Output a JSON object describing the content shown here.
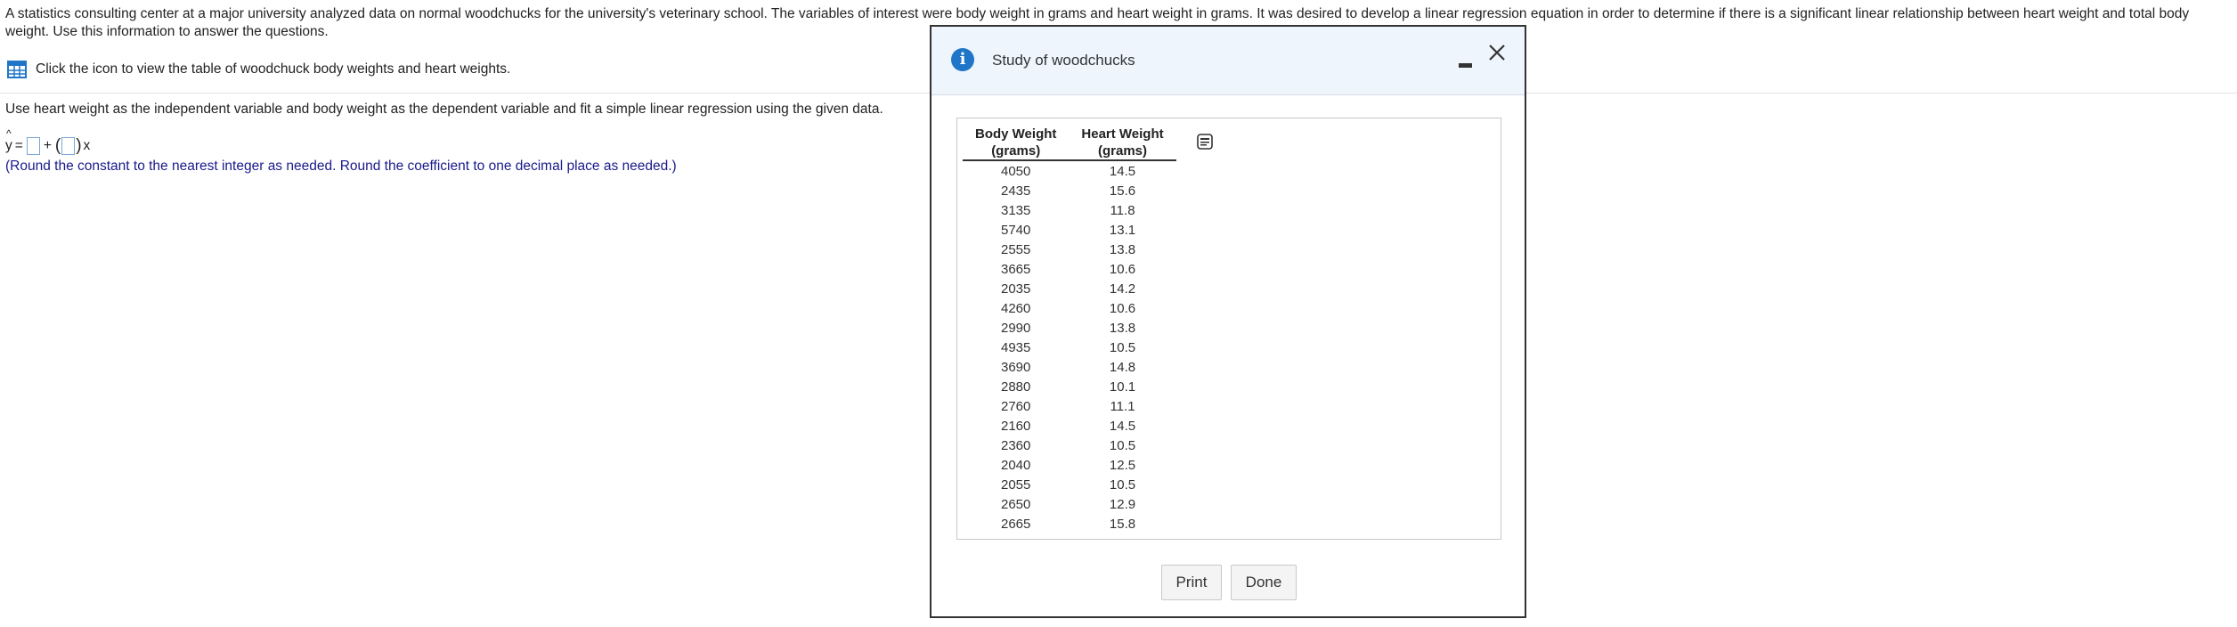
{
  "question": {
    "intro": "A statistics consulting center at a major university analyzed data on normal woodchucks for the university's veterinary school. The variables of interest were body weight in grams and heart weight in grams. It was desired to develop a linear regression equation in order to determine if there is a significant linear relationship between heart weight and total body weight. Use this information to answer the questions.",
    "icon_prompt": "Click the icon to view the table of woodchuck body weights and heart weights.",
    "instruction": "Use heart weight as the independent variable and body weight as the dependent variable and fit a simple linear regression using the given data.",
    "equation": {
      "lhs": "y",
      "hat": "^",
      "equals": "=",
      "plus": "+",
      "open_paren": "(",
      "close_paren": ")",
      "var": "x"
    },
    "hint": "(Round the constant to the nearest integer as needed. Round the coefficient to one decimal place as needed.)"
  },
  "icons": {
    "table": "table-grid-icon",
    "info": "info-icon",
    "minimize": "minimize-icon",
    "close": "close-icon",
    "copy": "copy-icon"
  },
  "colors": {
    "accent": "#1f76c8",
    "hint_text": "#1a1a8c",
    "modal_header": "#eef5fd"
  },
  "modal": {
    "title": "Study of woodchucks",
    "info_glyph": "i",
    "table": {
      "headers": [
        {
          "line1": "Body Weight",
          "line2": "(grams)"
        },
        {
          "line1": "Heart Weight",
          "line2": "(grams)"
        }
      ],
      "rows": [
        [
          "4050",
          "14.5"
        ],
        [
          "2435",
          "15.6"
        ],
        [
          "3135",
          "11.8"
        ],
        [
          "5740",
          "13.1"
        ],
        [
          "2555",
          "13.8"
        ],
        [
          "3665",
          "10.6"
        ],
        [
          "2035",
          "14.2"
        ],
        [
          "4260",
          "10.6"
        ],
        [
          "2990",
          "13.8"
        ],
        [
          "4935",
          "10.5"
        ],
        [
          "3690",
          "14.8"
        ],
        [
          "2880",
          "10.1"
        ],
        [
          "2760",
          "11.1"
        ],
        [
          "2160",
          "14.5"
        ],
        [
          "2360",
          "10.5"
        ],
        [
          "2040",
          "12.5"
        ],
        [
          "2055",
          "10.5"
        ],
        [
          "2650",
          "12.9"
        ],
        [
          "2665",
          "15.8"
        ]
      ]
    },
    "buttons": {
      "print": "Print",
      "done": "Done"
    }
  }
}
